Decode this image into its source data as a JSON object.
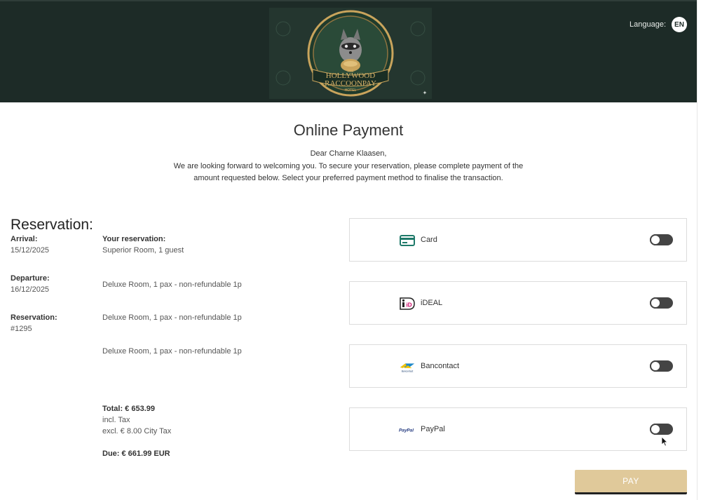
{
  "header": {
    "logo": {
      "line1": "THE",
      "line2": "HOLLYWOOD",
      "line3": "RACCOONPAY",
      "line4": "HOTEL"
    },
    "language_label": "Language:",
    "language_code": "EN"
  },
  "page": {
    "title": "Online Payment",
    "greeting": "Dear Charne Klaasen,",
    "intro": "We are looking forward to welcoming you. To secure your reservation, please complete payment of the amount requested below. Select your preferred payment method to finalise the transaction."
  },
  "reservation": {
    "heading": "Reservation:",
    "arrival_label": "Arrival:",
    "arrival_value": "15/12/2025",
    "departure_label": "Departure:",
    "departure_value": "16/12/2025",
    "reservation_label": "Reservation:",
    "reservation_value": "#1295",
    "your_reservation_label": "Your reservation:",
    "rooms": [
      "Superior Room, 1 guest",
      "Deluxe Room, 1 pax - non-refundable 1p",
      "Deluxe Room, 1 pax - non-refundable 1p",
      "Deluxe Room, 1 pax - non-refundable 1p"
    ],
    "total": "Total: € 653.99",
    "incl_tax": "incl. Tax",
    "excl_tax": "excl. € 8.00 City Tax",
    "due": "Due: € 661.99 EUR"
  },
  "payment_methods": [
    {
      "label": "Card",
      "icon": "credit-card-icon",
      "enabled": false
    },
    {
      "label": "iDEAL",
      "icon": "ideal-icon",
      "enabled": false
    },
    {
      "label": "Bancontact",
      "icon": "bancontact-icon",
      "enabled": false
    },
    {
      "label": "PayPal",
      "icon": "paypal-icon",
      "enabled": false
    }
  ],
  "icon_text": {
    "ideal_mark": "iD",
    "bancontact_mark": "Bancontact",
    "paypal_mark": "PayPal"
  },
  "pay_button": "PAY",
  "colors": {
    "header_bg": "#1d2b27",
    "pay_button": "#e0c99a",
    "logo_gold": "#c9a45c"
  }
}
